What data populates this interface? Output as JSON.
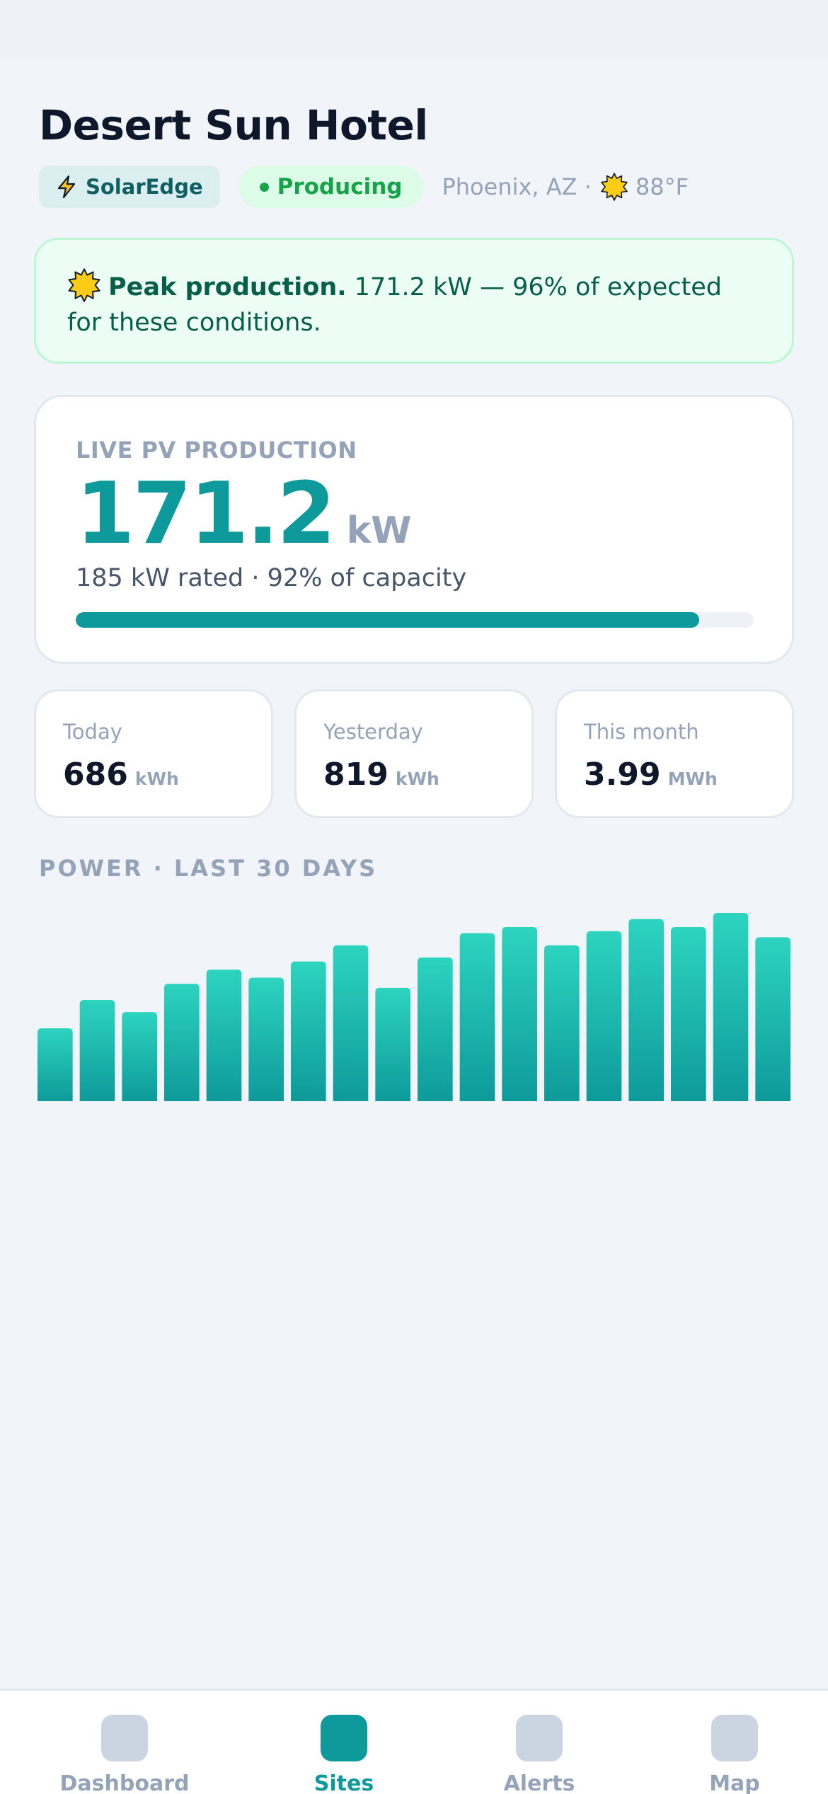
{
  "site": {
    "title": "Desert Sun Hotel",
    "vendor": "SolarEdge",
    "status": "Producing",
    "location": "Phoenix, AZ ·",
    "temperature": "88°F"
  },
  "banner": {
    "headline": "Peak production.",
    "text": " 171.2 kW — 96% of expected for these conditions."
  },
  "live": {
    "label": "LIVE PV PRODUCTION",
    "value": "171.2",
    "unit": "kW",
    "subtitle": "185 kW rated · 92% of capacity",
    "capacity_fraction": 0.92
  },
  "stats": [
    {
      "label": "Today",
      "value": "686",
      "unit": "kWh"
    },
    {
      "label": "Yesterday",
      "value": "819",
      "unit": "kWh"
    },
    {
      "label": "This month",
      "value": "3.99",
      "unit": "MWh"
    }
  ],
  "chart_title": "POWER · LAST 30 DAYS",
  "chart_data": {
    "type": "bar",
    "title": "POWER · LAST 30 DAYS",
    "xlabel": "",
    "ylabel": "",
    "values": [
      36,
      50,
      44,
      58,
      65,
      61,
      69,
      77,
      56,
      71,
      83,
      86,
      77,
      84,
      90,
      86,
      93,
      81
    ],
    "ylim": [
      0,
      100
    ],
    "grid": false,
    "colors": {
      "top": "#2dd4bf",
      "bottom": "#0e9a9a"
    }
  },
  "colors": {
    "accent": "#0e9a9a",
    "status_green": "#16a34a",
    "muted": "#94a3b8"
  },
  "tabs": [
    {
      "label": "Dashboard",
      "icon": "dashboard-icon",
      "active": false
    },
    {
      "label": "Sites",
      "icon": "sites-icon",
      "active": true
    },
    {
      "label": "Alerts",
      "icon": "alerts-icon",
      "active": false
    },
    {
      "label": "Map",
      "icon": "map-icon",
      "active": false
    }
  ]
}
